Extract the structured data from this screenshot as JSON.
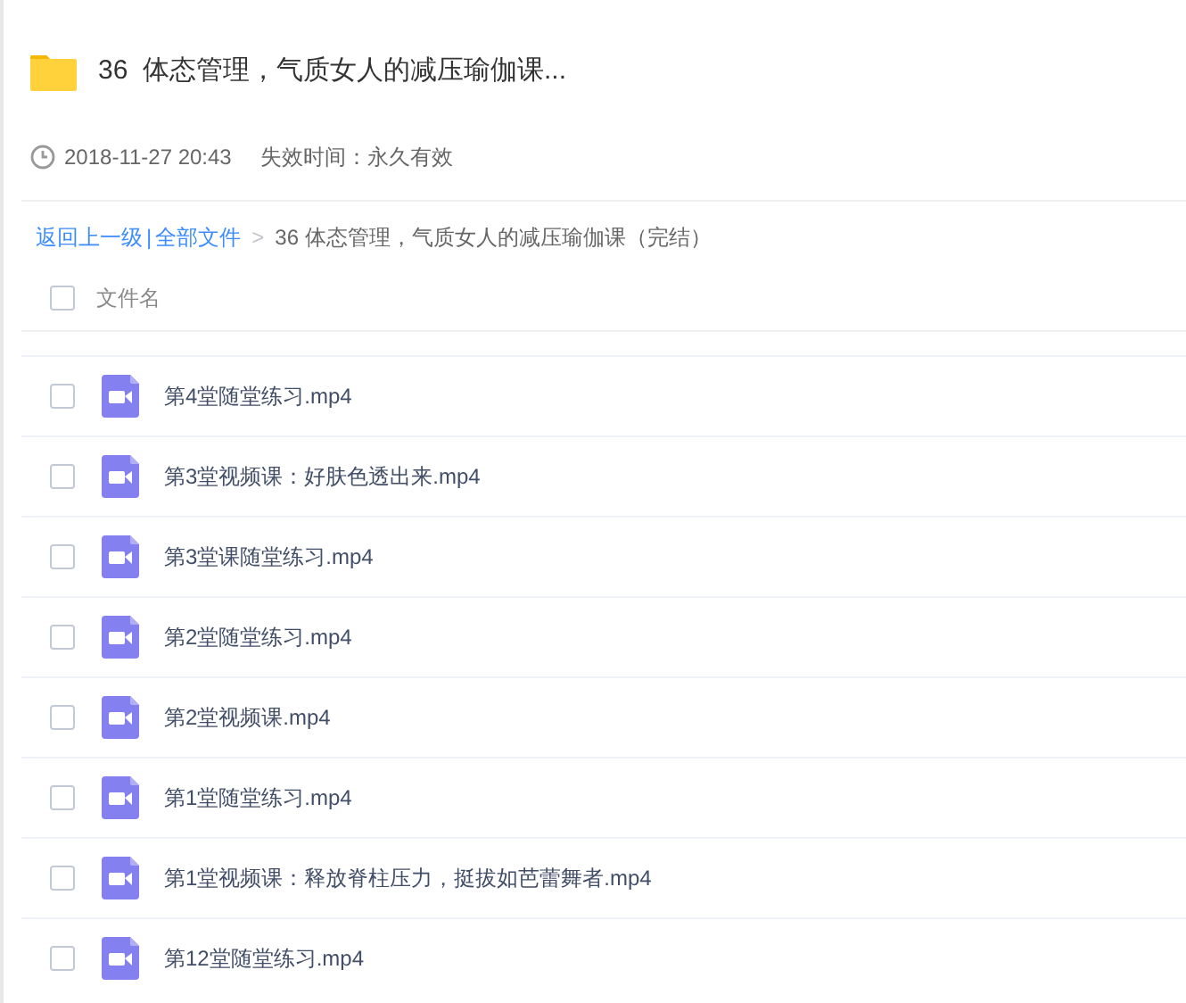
{
  "title": "36  体态管理，气质女人的减压瑜伽课...",
  "meta": {
    "created": "2018-11-27 20:43",
    "expiry": "失效时间：永久有效"
  },
  "breadcrumb": {
    "back": "返回上一级",
    "separator": "|",
    "root": "全部文件",
    "arrow": ">",
    "current": "36 体态管理，气质女人的减压瑜伽课（完结）"
  },
  "table": {
    "header": {
      "label": "文件名",
      "checked": false
    },
    "rows": [
      {
        "name": "第4堂随堂练习.mp4",
        "checked": false
      },
      {
        "name": "第3堂视频课：好肤色透出来.mp4",
        "checked": false
      },
      {
        "name": "第3堂课随堂练习.mp4",
        "checked": false
      },
      {
        "name": "第2堂随堂练习.mp4",
        "checked": false
      },
      {
        "name": "第2堂视频课.mp4",
        "checked": false
      },
      {
        "name": "第1堂随堂练习.mp4",
        "checked": false
      },
      {
        "name": "第1堂视频课：释放脊柱压力，挺拔如芭蕾舞者.mp4",
        "checked": false
      },
      {
        "name": "第12堂随堂练习.mp4",
        "checked": false
      }
    ]
  }
}
